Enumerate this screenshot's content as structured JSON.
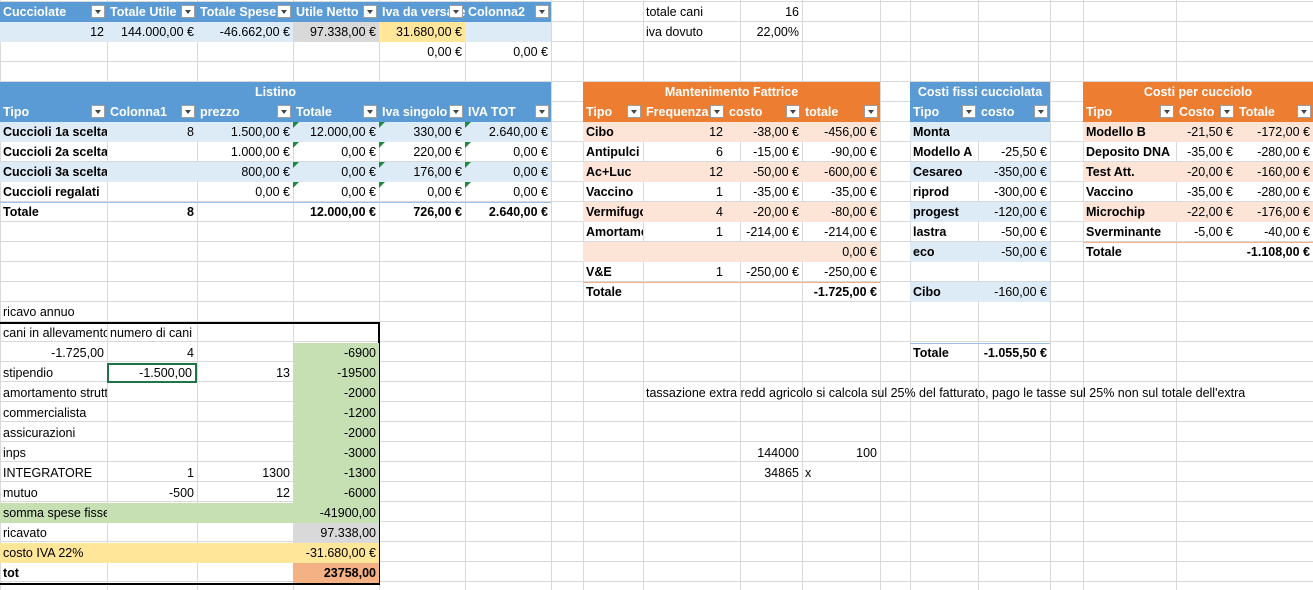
{
  "colors": {
    "blue_header": "#5b9bd5",
    "orange_header": "#ed7d31",
    "light_blue": "#ddebf7",
    "light_orange": "#fce4d6",
    "green": "#c6e0b4",
    "yellow": "#ffe699",
    "salmon": "#f4b183"
  },
  "top_table": {
    "headers": [
      "Cucciolate",
      "Totale Utile",
      "Totale Spese",
      "Utile Netto",
      "Iva da versare",
      "Colonna2"
    ],
    "row": [
      "12",
      "144.000,00 €",
      "-46.662,00 €",
      "97.338,00 €",
      "31.680,00 €",
      ""
    ],
    "extra_row": [
      "0,00 €",
      "0,00 €"
    ]
  },
  "summary": {
    "totale_cani_label": "totale cani",
    "totale_cani_value": "16",
    "iva_label": "iva dovuto",
    "iva_value": "22,00%"
  },
  "listino": {
    "title": "Listino",
    "headers": [
      "Tipo",
      "Colonna1",
      "prezzo",
      "Totale",
      "Iva singolo",
      "IVA TOT"
    ],
    "rows": [
      [
        "Cuccioli 1a scelta",
        "8",
        "1.500,00 €",
        "12.000,00 €",
        "330,00 €",
        "2.640,00 €"
      ],
      [
        "Cuccioli 2a scelta",
        "",
        "1.000,00 €",
        "0,00 €",
        "220,00 €",
        "0,00 €"
      ],
      [
        "Cuccioli 3a scelta",
        "",
        "800,00 €",
        "0,00 €",
        "176,00 €",
        "0,00 €"
      ],
      [
        "Cuccioli regalati",
        "",
        "0,00 €",
        "0,00 €",
        "0,00 €",
        "0,00 €"
      ]
    ],
    "total": [
      "Totale",
      "8",
      "",
      "12.000,00 €",
      "726,00 €",
      "2.640,00 €"
    ]
  },
  "mantenimento": {
    "title": "Mantenimento Fattrice",
    "headers": [
      "Tipo",
      "Frequenza",
      "costo",
      "totale"
    ],
    "rows": [
      [
        "Cibo",
        "12",
        "-38,00 €",
        "-456,00 €"
      ],
      [
        "Antipulci",
        "6",
        "-15,00 €",
        "-90,00 €"
      ],
      [
        "Ac+Luc",
        "12",
        "-50,00 €",
        "-600,00 €"
      ],
      [
        "Vaccino",
        "1",
        "-35,00 €",
        "-35,00 €"
      ],
      [
        "Vermifugo",
        "4",
        "-20,00 €",
        "-80,00 €"
      ],
      [
        "Amortamento",
        "1",
        "-214,00 €",
        "-214,00 €"
      ],
      [
        "",
        "",
        "",
        "0,00 €"
      ],
      [
        "V&E",
        "1",
        "-250,00 €",
        "-250,00 €"
      ]
    ],
    "total": [
      "Totale",
      "",
      "",
      "-1.725,00 €"
    ]
  },
  "costi_fissi": {
    "title": "Costi fissi cucciolata",
    "headers": [
      "Tipo",
      "costo"
    ],
    "rows": [
      [
        "Monta",
        ""
      ],
      [
        "Modello A",
        "-25,50 €"
      ],
      [
        "Cesareo",
        "-350,00 €"
      ],
      [
        "riprod",
        "-300,00 €"
      ],
      [
        "progest",
        "-120,00 €"
      ],
      [
        "lastra",
        "-50,00 €"
      ],
      [
        "eco",
        "-50,00 €"
      ],
      [
        "",
        ""
      ],
      [
        "Cibo",
        "-160,00 €"
      ],
      [
        "",
        ""
      ]
    ],
    "total": [
      "Totale",
      "-1.055,50 €"
    ]
  },
  "costi_cucciolo": {
    "title": "Costi per cucciolo",
    "headers": [
      "Tipo",
      "Costo",
      "Totale"
    ],
    "rows": [
      [
        "Modello B",
        "-21,50 €",
        "-172,00 €"
      ],
      [
        "Deposito DNA",
        "-35,00 €",
        "-280,00 €"
      ],
      [
        "Test Att.",
        "-20,00 €",
        "-160,00 €"
      ],
      [
        "Vaccino",
        "-35,00 €",
        "-280,00 €"
      ],
      [
        "Microchip",
        "-22,00 €",
        "-176,00 €"
      ],
      [
        "Sverminante",
        "-5,00 €",
        "-40,00 €"
      ]
    ],
    "total": [
      "Totale",
      "",
      "-1.108,00 €"
    ]
  },
  "ricavo": {
    "title": "ricavo annuo",
    "header": [
      "cani in allevamento",
      "numero di cani"
    ],
    "rows": [
      [
        "-1.725,00",
        "4",
        "",
        "-6900"
      ],
      [
        "stipendio",
        "-1.500,00",
        "13",
        "-19500"
      ],
      [
        "amortamento strutture",
        "",
        "",
        "-2000"
      ],
      [
        "commercialista",
        "",
        "",
        "-1200"
      ],
      [
        "assicurazioni",
        "",
        "",
        "-2000"
      ],
      [
        "inps",
        "",
        "",
        "-3000"
      ],
      [
        "INTEGRATORE",
        "1",
        "1300",
        "-1300"
      ],
      [
        "mutuo",
        "-500",
        "12",
        "-6000"
      ],
      [
        "somma spese fisse",
        "",
        "",
        "-41900,00"
      ],
      [
        "ricavato",
        "",
        "",
        "97.338,00"
      ],
      [
        "costo IVA 22%",
        "",
        "",
        "-31.680,00 €"
      ],
      [
        "tot",
        "",
        "",
        "23758,00"
      ]
    ]
  },
  "note": "tassazione extra redd agricolo si calcola sul 25% del fatturato, pago le tasse sul 25% non sul totale dell'extra",
  "proportion": {
    "a": "144000",
    "b": "100",
    "c": "34865",
    "d": "x"
  }
}
